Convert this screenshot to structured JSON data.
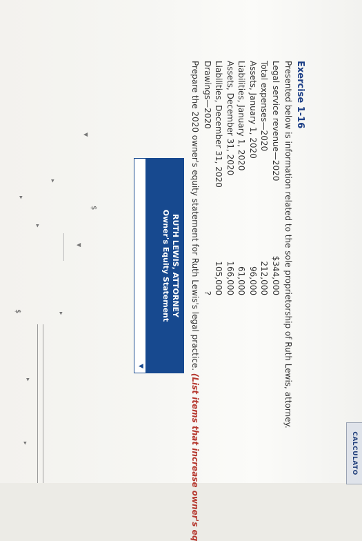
{
  "header": {
    "calculator_tab": "CALCULATO"
  },
  "exercise": {
    "title": "Exercise 1-16",
    "intro": "Presented below is information related to the sole proprietorship of Ruth Lewis, attorney."
  },
  "rows": [
    {
      "label": "Legal service revenue—2020",
      "value": "$344,000"
    },
    {
      "label": "Total expenses—2020",
      "value": "212,000"
    },
    {
      "label": "Assets, January 1, 2020",
      "value": "96,000"
    },
    {
      "label": "Liabilities, January 1, 2020",
      "value": "61,000"
    },
    {
      "label": "Assets, December 31, 2020",
      "value": "166,000"
    },
    {
      "label": "Liabilities, December 31, 2020",
      "value": "105,000"
    },
    {
      "label": "Drawings—2020",
      "value": "?"
    }
  ],
  "instructions": {
    "text": "Prepare the 2020 owner's equity statement for Ruth Lewis's legal practice.",
    "hint": "(List items that increase owner's eq"
  },
  "statement": {
    "company": "RUTH LEWIS, ATTORNEY",
    "title": "Owner's Equity Statement",
    "dollar_sign": "$"
  }
}
